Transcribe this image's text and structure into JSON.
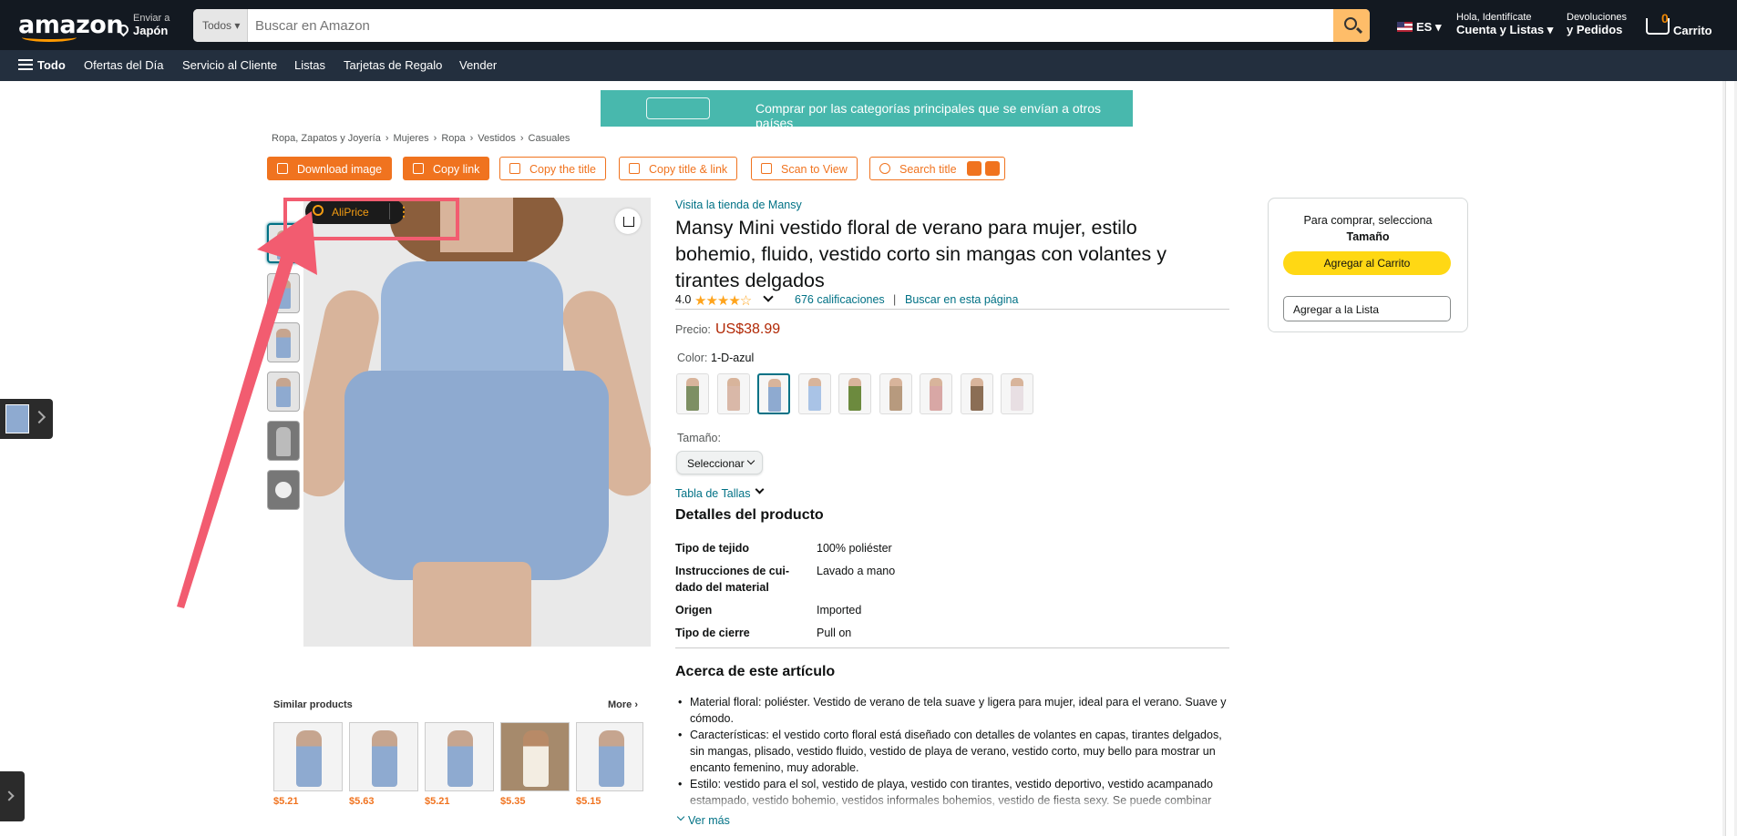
{
  "header": {
    "logo": "amazon",
    "deliver_line1": "Enviar a",
    "deliver_line2": "Japón",
    "search_category": "Todos",
    "search_placeholder": "Buscar en Amazon",
    "language": "ES",
    "account_line1": "Hola, Identifícate",
    "account_line2": "Cuenta y Listas",
    "returns_line1": "Devoluciones",
    "returns_line2": "y Pedidos",
    "cart_count": "0",
    "cart_label": "Carrito"
  },
  "subnav": {
    "menu_label": "Todo",
    "items": [
      "Ofertas del Día",
      "Servicio al Cliente",
      "Listas",
      "Tarjetas de Regalo",
      "Vender"
    ]
  },
  "banner": {
    "text": "Comprar por las categorías principales que se envían a otros países"
  },
  "breadcrumb": [
    "Ropa, Zapatos y Joyería",
    "Mujeres",
    "Ropa",
    "Vestidos",
    "Casuales"
  ],
  "toolbar": {
    "download_image": "Download image",
    "copy_link": "Copy link",
    "copy_title": "Copy the title",
    "copy_title_link": "Copy title & link",
    "scan_to_view": "Scan to View",
    "search_title": "Search title"
  },
  "overlay": {
    "aliprice": "AliPrice",
    "menu_glyph": "⋮"
  },
  "similar": {
    "title": "Similar products",
    "more": "More",
    "prices": [
      "$5.21",
      "$5.63",
      "$5.21",
      "$5.35",
      "$5.15"
    ]
  },
  "product": {
    "store": "Visita la tienda de Mansy",
    "title": "Mansy Mini vestido floral de verano para mujer, estilo bohemio, fluido, vestido corto sin mangas con volantes y tirantes delgados",
    "rating_value": "4.0",
    "stars": "★★★★☆",
    "ratings_count": "676 calificaciones",
    "rating_sep": "|",
    "search_page": "Buscar en esta página",
    "price_label": "Precio:",
    "price": "US$38.99",
    "color_label": "Color:",
    "color_value": "1-D-azul",
    "swatch_colors": [
      "#7d8f63",
      "#d9b8a8",
      "#8eaad0",
      "#a9c3e6",
      "#6c8a3e",
      "#b79a7e",
      "#d8a7a5",
      "#8b6e55",
      "#e8dfe3"
    ],
    "size_label": "Tamaño:",
    "size_select": "Seleccionar",
    "size_table": "Tabla de Tallas",
    "details_title": "Detalles del producto",
    "details": [
      {
        "label": "Tipo de tejido",
        "value": "100% poliéster"
      },
      {
        "label": "Instrucciones de cui-\ndado del material",
        "value": "Lavado a mano"
      },
      {
        "label": "Origen",
        "value": "Imported"
      },
      {
        "label": "Tipo de cierre",
        "value": "Pull on"
      }
    ],
    "about_title": "Acerca de este artículo",
    "bullets": [
      "Material floral: poliéster. Vestido de verano de tela suave y ligera para mujer, ideal para el verano. Suave y cómodo.",
      "Características: el vestido corto floral está diseñado con detalles de volantes en capas, tirantes delgados, sin mangas, plisado, vestido fluido, vestido de playa de verano, vestido corto, muy bello para mostrar un encanto femenino, muy adorable.",
      "Estilo: vestido para el sol, vestido de playa, vestido con tirantes, vestido deportivo, vestido acampanado estampado, vestido bohemio, vestidos informales bohemios, vestido de fiesta sexy. Se puede combinar"
    ],
    "see_more": "Ver más"
  },
  "buybox": {
    "prompt": "Para comprar, selecciona",
    "prompt_bold": "Tamaño",
    "add_to_cart": "Agregar al Carrito",
    "add_to_list": "Agregar a la Lista"
  },
  "colors": {
    "nav_bg": "#131921",
    "subnav_bg": "#232f3e",
    "accent_orange": "#f0731f",
    "link": "#007185",
    "price": "#b12704",
    "cart_button": "#ffd814",
    "banner": "#48b8ad",
    "highlight": "#f25c70"
  }
}
